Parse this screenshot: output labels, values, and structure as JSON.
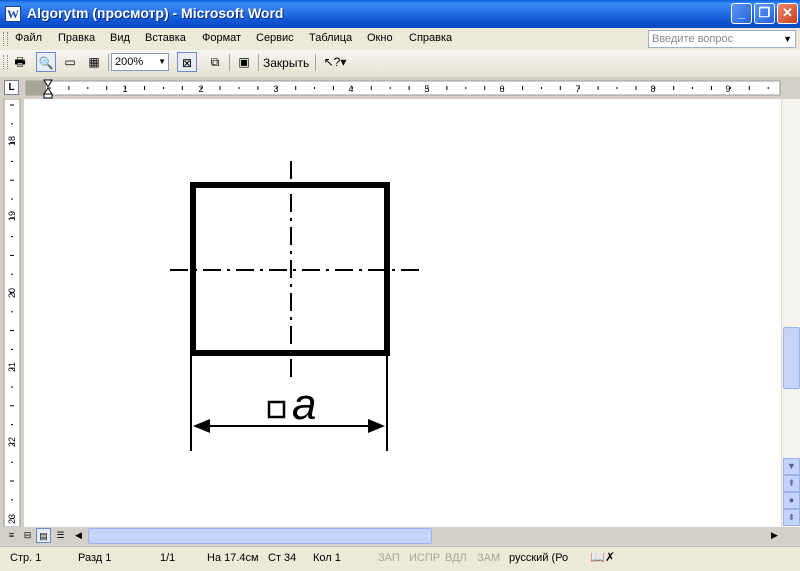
{
  "window": {
    "title": "Algorytm (просмотр) - Microsoft Word",
    "app_icon": "W"
  },
  "menu": {
    "items": [
      "Файл",
      "Правка",
      "Вид",
      "Вставка",
      "Формат",
      "Сервис",
      "Таблица",
      "Окно",
      "Справка"
    ],
    "ask_placeholder": "Введите вопрос"
  },
  "toolbar": {
    "zoom": "200%",
    "close_label": "Закрыть"
  },
  "ruler": {
    "corner_label": "L",
    "h_numbers": [
      "1",
      "2",
      "3",
      "4",
      "5",
      "6",
      "7",
      "8",
      "9"
    ],
    "v_numbers": [
      "18",
      "19",
      "20",
      "21",
      "22",
      "23"
    ]
  },
  "document": {
    "dimension_label": "a"
  },
  "status": {
    "page": "Стр. 1",
    "section": "Разд 1",
    "pages": "1/1",
    "at": "На 17.4см",
    "line": "Ст 34",
    "col": "Кол 1",
    "rec": "ЗАП",
    "trk": "ИСПР",
    "ext": "ВДЛ",
    "ovr": "ЗАМ",
    "language": "русский (Ро"
  },
  "colors": {
    "title_bar": "#2b74ea",
    "menu_bg": "#ece9d8",
    "page_bg": "#ffffff",
    "drawing_ink": "#000000"
  }
}
